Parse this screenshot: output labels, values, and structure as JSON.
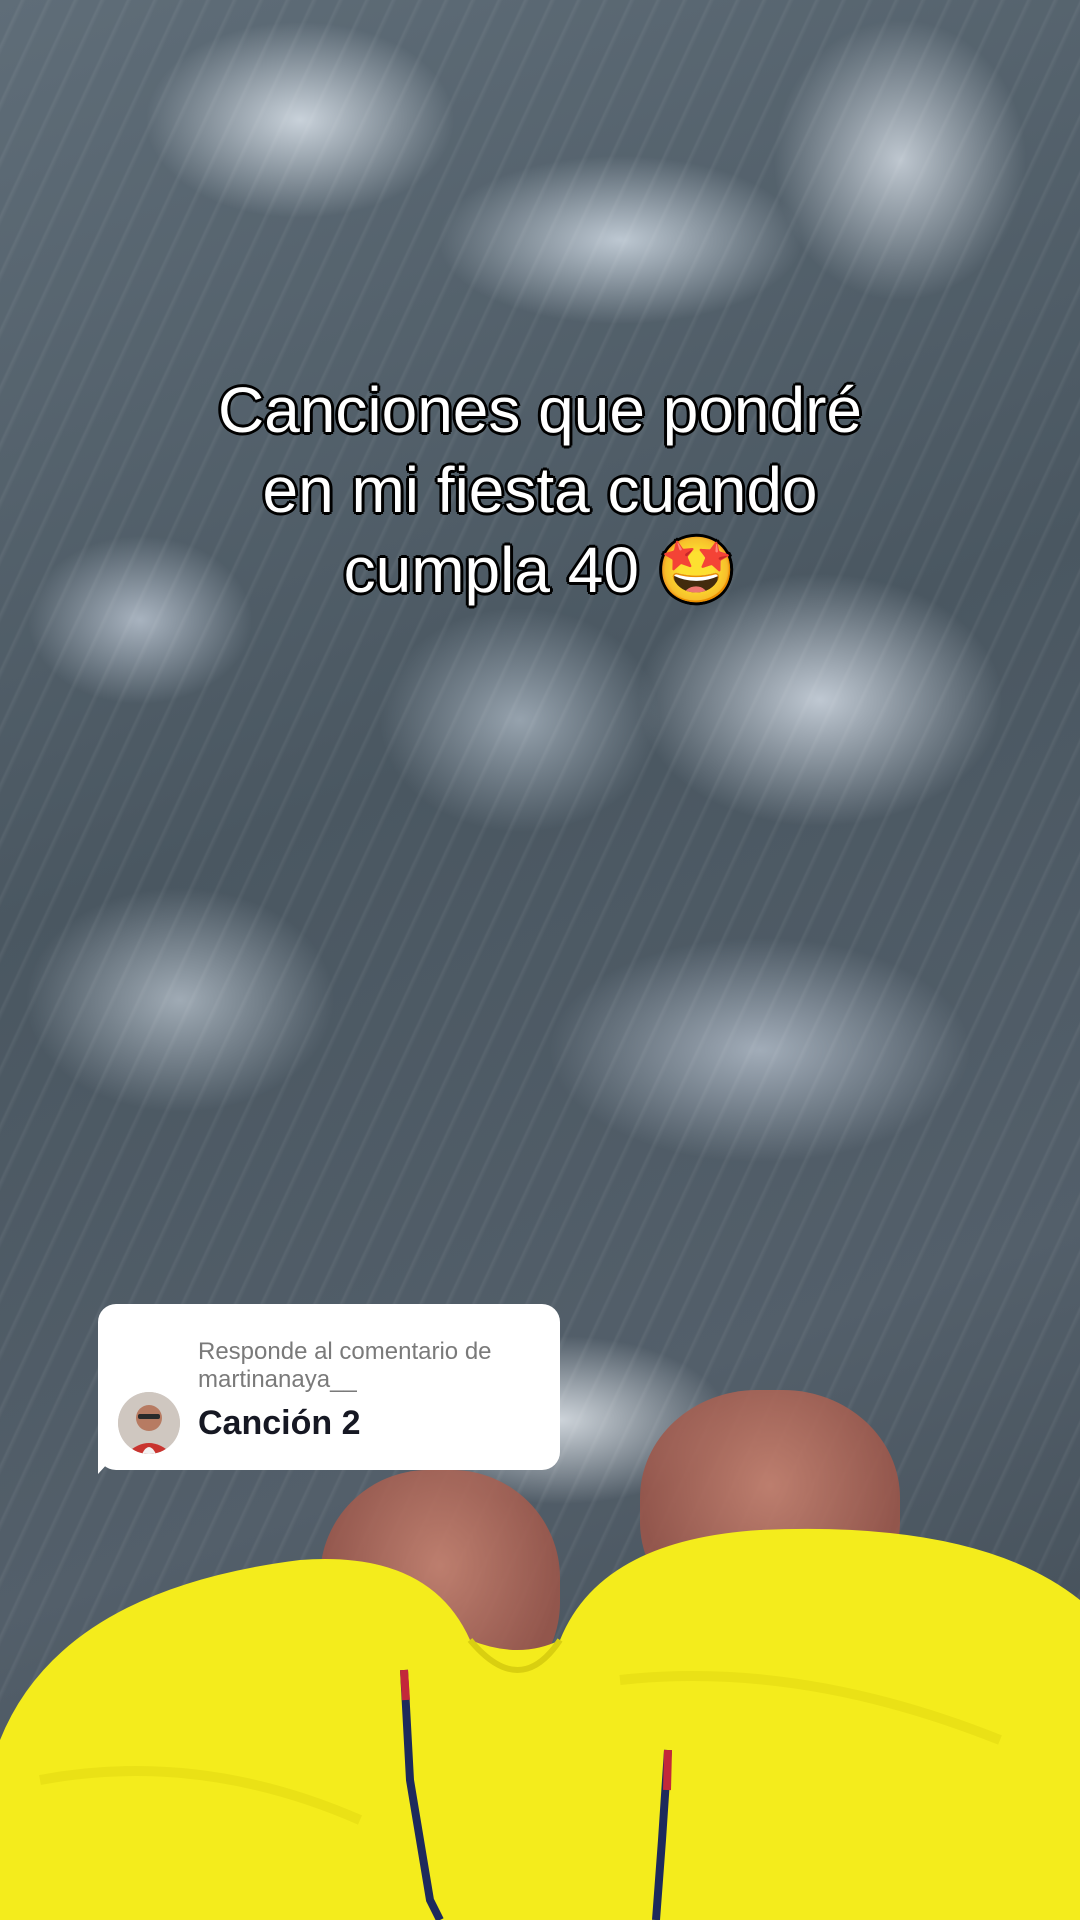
{
  "video": {
    "caption_lines": [
      "Canciones que pondré",
      "en mi fiesta cuando",
      "cumpla 40 🤩"
    ]
  },
  "reply_card": {
    "label": "Responde al comentario de",
    "username": "martinanaya__",
    "comment": "Canción 2"
  },
  "colors": {
    "shorts": "#f4ec1c",
    "drawstring_red": "#c3273a",
    "drawstring_navy": "#1d2a5c"
  }
}
